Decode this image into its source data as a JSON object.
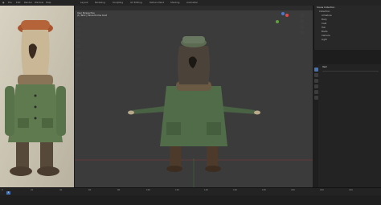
{
  "app": {
    "menus": [
      "File",
      "Edit",
      "Render",
      "Window",
      "Help",
      "Layout",
      "Modeling",
      "Sculpting",
      "UV Editing",
      "Texture Paint",
      "Shading",
      "Animation"
    ]
  },
  "viewport": {
    "overlay_line1": "User Perspective",
    "overlay_line2": "(1) Tahir | Monochrome Coat"
  },
  "outliner": {
    "header": "Scene Collection",
    "items": [
      "Collection",
      "Armature",
      "Body",
      "Coat",
      "Hat",
      "Boots",
      "Camera",
      "Light"
    ]
  },
  "properties": {
    "header": "Item"
  },
  "timeline": {
    "frames": [
      "0",
      "20",
      "40",
      "60",
      "80",
      "100",
      "120",
      "140",
      "160",
      "180",
      "200",
      "220",
      "240"
    ],
    "current_frame": "1"
  },
  "colors": {
    "accent": "#4772b3",
    "coat_green": "#4b6a45",
    "boot_brown": "#4e3a2a",
    "viewport_bg": "#3b3b3b"
  }
}
